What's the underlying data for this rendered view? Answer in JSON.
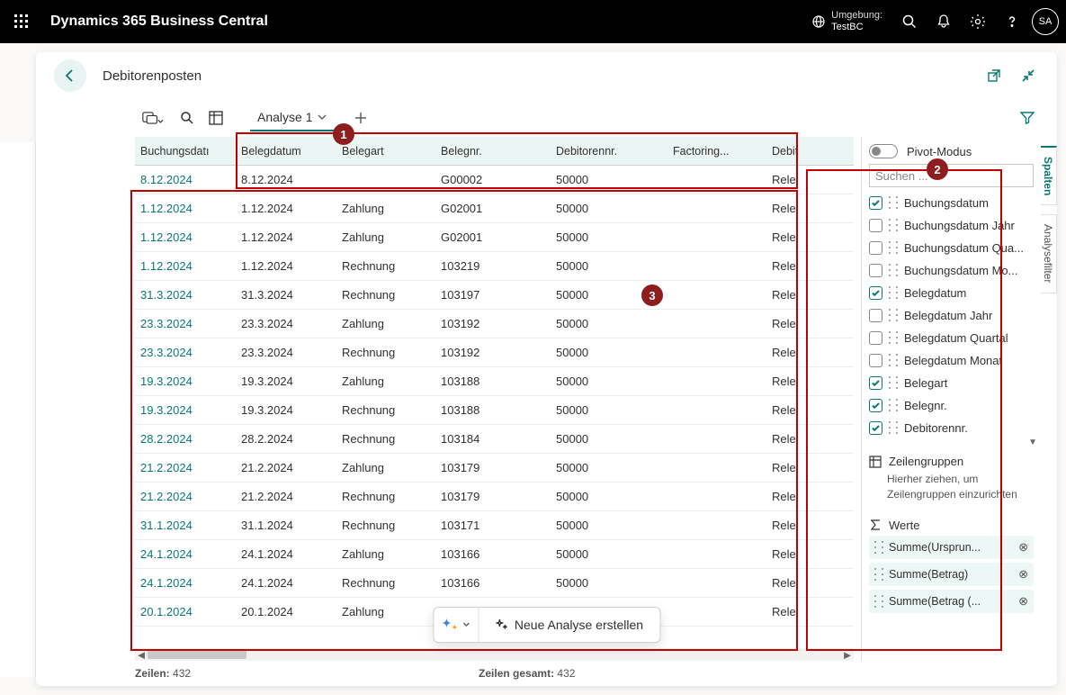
{
  "header": {
    "appTitle": "Dynamics 365 Business Central",
    "envLabel": "Umgebung:",
    "envName": "TestBC",
    "avatarInitials": "SA"
  },
  "page": {
    "title": "Debitorenposten",
    "analysisTab": "Analyse 1",
    "pivotModeLabel": "Pivot-Modus",
    "searchPlaceholder": "Suchen ...",
    "rowGroupsLabel": "Zeilengruppen",
    "rowGroupsHint": "Hierher ziehen, um Zeilengruppen einzurichten",
    "valuesLabel": "Werte",
    "sideTab1": "Spalten",
    "sideTab2": "Analysefilter",
    "copilot": "Neue Analyse erstellen",
    "statusRows": "Zeilen:",
    "statusRowsVal": "432",
    "statusTotal": "Zeilen gesamt:",
    "statusTotalVal": "432"
  },
  "columns": [
    "Buchungsdatı",
    "Belegdatum",
    "Belegart",
    "Belegnr.",
    "Debitorennr.",
    "Factoring...",
    "Debit"
  ],
  "rows": [
    [
      "8.12.2024",
      "8.12.2024",
      "",
      "G00002",
      "50000",
      "",
      "Rele"
    ],
    [
      "1.12.2024",
      "1.12.2024",
      "Zahlung",
      "G02001",
      "50000",
      "",
      "Rele"
    ],
    [
      "1.12.2024",
      "1.12.2024",
      "Zahlung",
      "G02001",
      "50000",
      "",
      "Rele"
    ],
    [
      "1.12.2024",
      "1.12.2024",
      "Rechnung",
      "103219",
      "50000",
      "",
      "Rele"
    ],
    [
      "31.3.2024",
      "31.3.2024",
      "Rechnung",
      "103197",
      "50000",
      "",
      "Rele"
    ],
    [
      "23.3.2024",
      "23.3.2024",
      "Zahlung",
      "103192",
      "50000",
      "",
      "Rele"
    ],
    [
      "23.3.2024",
      "23.3.2024",
      "Rechnung",
      "103192",
      "50000",
      "",
      "Rele"
    ],
    [
      "19.3.2024",
      "19.3.2024",
      "Zahlung",
      "103188",
      "50000",
      "",
      "Rele"
    ],
    [
      "19.3.2024",
      "19.3.2024",
      "Rechnung",
      "103188",
      "50000",
      "",
      "Rele"
    ],
    [
      "28.2.2024",
      "28.2.2024",
      "Rechnung",
      "103184",
      "50000",
      "",
      "Rele"
    ],
    [
      "21.2.2024",
      "21.2.2024",
      "Zahlung",
      "103179",
      "50000",
      "",
      "Rele"
    ],
    [
      "21.2.2024",
      "21.2.2024",
      "Rechnung",
      "103179",
      "50000",
      "",
      "Rele"
    ],
    [
      "31.1.2024",
      "31.1.2024",
      "Rechnung",
      "103171",
      "50000",
      "",
      "Rele"
    ],
    [
      "24.1.2024",
      "24.1.2024",
      "Zahlung",
      "103166",
      "50000",
      "",
      "Rele"
    ],
    [
      "24.1.2024",
      "24.1.2024",
      "Rechnung",
      "103166",
      "50000",
      "",
      "Rele"
    ],
    [
      "20.1.2024",
      "20.1.2024",
      "Zahlung",
      "",
      "",
      "",
      "Rele"
    ]
  ],
  "columnFields": [
    {
      "label": "Buchungsdatum",
      "checked": true
    },
    {
      "label": "Buchungsdatum Jahr",
      "checked": false
    },
    {
      "label": "Buchungsdatum Qua...",
      "checked": false
    },
    {
      "label": "Buchungsdatum Mo...",
      "checked": false
    },
    {
      "label": "Belegdatum",
      "checked": true
    },
    {
      "label": "Belegdatum Jahr",
      "checked": false
    },
    {
      "label": "Belegdatum Quartal",
      "checked": false
    },
    {
      "label": "Belegdatum Monat",
      "checked": false
    },
    {
      "label": "Belegart",
      "checked": true
    },
    {
      "label": "Belegnr.",
      "checked": true
    },
    {
      "label": "Debitorennr.",
      "checked": true
    }
  ],
  "valueChips": [
    "Summe(Ursprun...",
    "Summe(Betrag)",
    "Summe(Betrag (..."
  ]
}
